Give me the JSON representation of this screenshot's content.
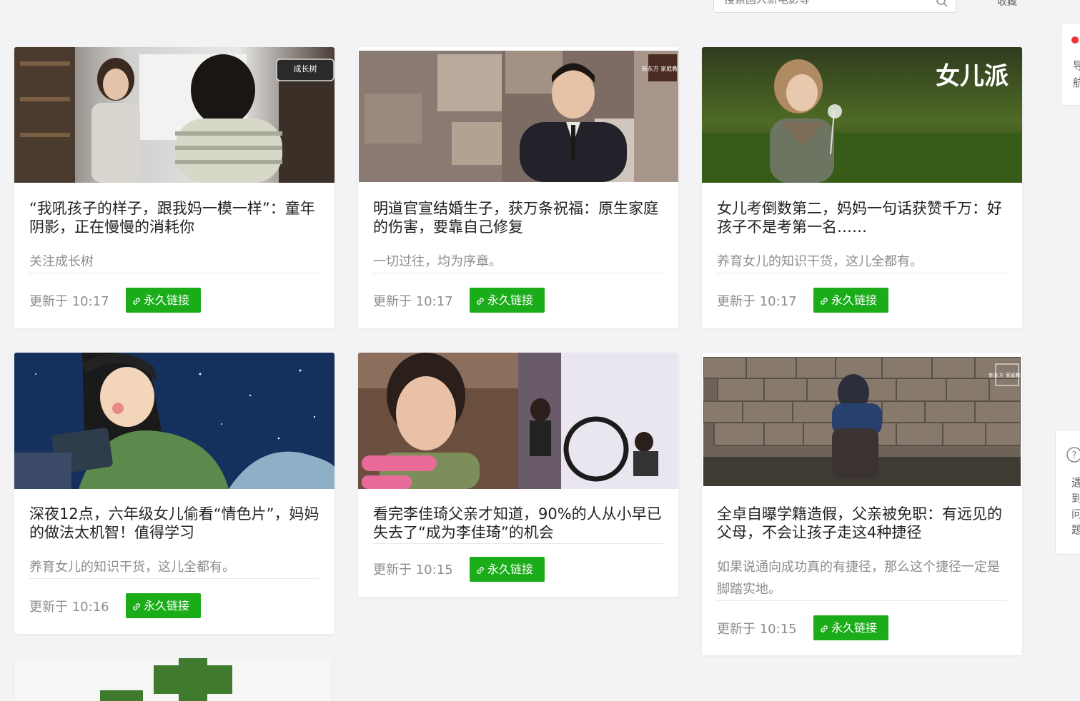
{
  "search": {
    "placeholder": "搜索国人新电影等"
  },
  "top_right": {
    "text": "收藏"
  },
  "cards": [
    {
      "title": "“我吼孩子的样子，跟我妈一模一样”：童年阴影，正在慢慢的消耗你",
      "desc": "关注成长树",
      "updated": "更新于 10:17",
      "link": "永久链接",
      "badge": "成长树"
    },
    {
      "title": "明道官宣结婚生子，获万条祝福：原生家庭的伤害，要靠自己修复",
      "desc": "一切过往，均为序章。",
      "updated": "更新于 10:17",
      "link": "永久链接",
      "badge": "新东方 家庭教育"
    },
    {
      "title": "女儿考倒数第二，妈妈一句话获赞千万：好孩子不是考第一名……",
      "desc": "养育女儿的知识干货，这儿全都有。",
      "updated": "更新于 10:17",
      "link": "永久链接",
      "badge": "女儿派"
    },
    {
      "title": "深夜12点，六年级女儿偷看“情色片”，妈妈的做法太机智！值得学习",
      "desc": "养育女儿的知识干货，这儿全都有。",
      "updated": "更新于 10:16",
      "link": "永久链接"
    },
    {
      "title": "看完李佳琦父亲才知道，90%的人从小早已失去了“成为李佳琦”的机会",
      "desc": "",
      "updated": "更新于 10:15",
      "link": "永久链接"
    },
    {
      "title": "全卓自曝学籍造假，父亲被免职：有远见的父母，不会让孩子走这4种捷径",
      "desc": "如果说通向成功真的有捷径，那么这个捷径一定是脚踏实地。",
      "updated": "更新于 10:15",
      "link": "永久链接",
      "badge": "新东方 家庭教育"
    }
  ],
  "side_top": {
    "line1": "导",
    "line2": "航"
  },
  "side_help": {
    "chars": [
      "遇",
      "到",
      "问",
      "题"
    ]
  },
  "colors": {
    "accent_green": "#1aad19",
    "background": "#f3f3f5"
  }
}
